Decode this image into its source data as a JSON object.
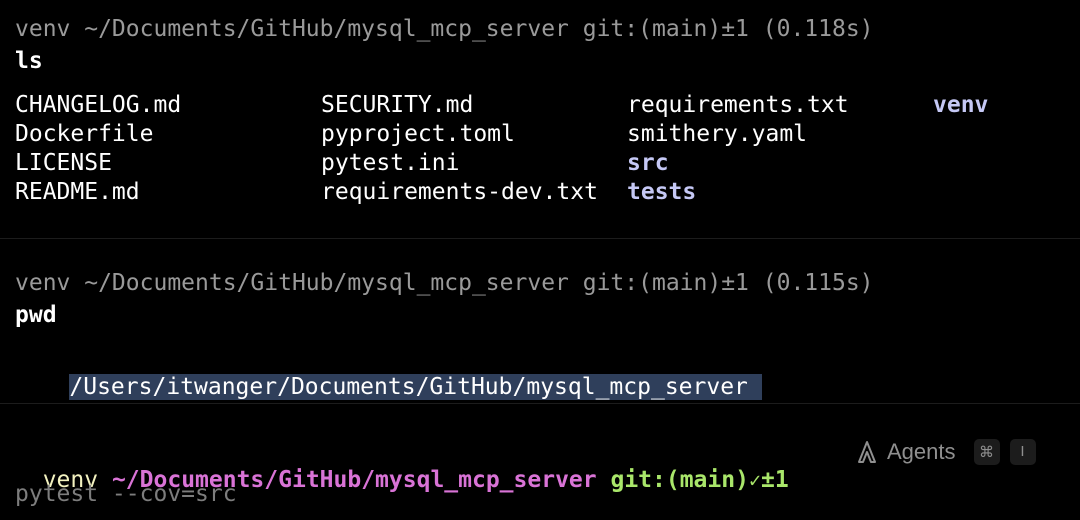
{
  "blocks": [
    {
      "prompt": "venv ~/Documents/GitHub/mysql_mcp_server git:(main)±1 (0.118s)",
      "command": "ls",
      "listing": {
        "columns": [
          [
            {
              "name": "CHANGELOG.md",
              "type": "file"
            },
            {
              "name": "Dockerfile",
              "type": "file"
            },
            {
              "name": "LICENSE",
              "type": "file"
            },
            {
              "name": "README.md",
              "type": "file"
            }
          ],
          [
            {
              "name": "SECURITY.md",
              "type": "file"
            },
            {
              "name": "pyproject.toml",
              "type": "file"
            },
            {
              "name": "pytest.ini",
              "type": "file"
            },
            {
              "name": "requirements-dev.txt",
              "type": "file"
            }
          ],
          [
            {
              "name": "requirements.txt",
              "type": "file"
            },
            {
              "name": "smithery.yaml",
              "type": "file"
            },
            {
              "name": "src",
              "type": "dir"
            },
            {
              "name": "tests",
              "type": "dir"
            }
          ],
          [
            {
              "name": "venv",
              "type": "dir"
            }
          ]
        ]
      }
    },
    {
      "prompt": "venv ~/Documents/GitHub/mysql_mcp_server git:(main)±1 (0.115s)",
      "command": "pwd",
      "output": "/Users/itwanger/Documents/GitHub/mysql_mcp_server"
    }
  ],
  "live_prompt": {
    "venv": "venv",
    "path": "~/Documents/GitHub/mysql_mcp_server",
    "git": "git:(main)",
    "check_glyph": "✓",
    "dirty": "±1"
  },
  "agents": {
    "label": "Agents",
    "icon": "agent-icon",
    "shortcut_key1": "⌘",
    "shortcut_key2": "I"
  },
  "input": {
    "value": "pytest --cov=src"
  },
  "colors": {
    "background": "#000000",
    "dim_prompt": "#9a9a9a",
    "dir": "#c5c8f5",
    "venv": "#f3f2c0",
    "path": "#d973d6",
    "git": "#a9e66a",
    "selection": "#2f3f5b"
  }
}
